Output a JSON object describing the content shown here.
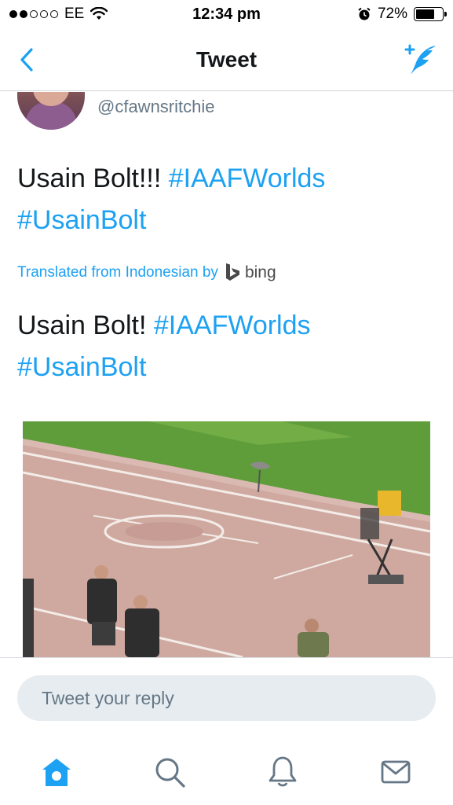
{
  "status_bar": {
    "carrier": "EE",
    "signal_filled": 2,
    "signal_total": 5,
    "time": "12:34 pm",
    "battery_text": "72%",
    "battery_level": 0.72,
    "icons": [
      "wifi-icon",
      "alarm-icon",
      "battery-icon"
    ]
  },
  "nav": {
    "title": "Tweet",
    "back_icon": "chevron-left-icon",
    "compose_icon": "compose-tweet-icon"
  },
  "tweet": {
    "handle": "@cfawnsritchie",
    "original_text": "Usain Bolt!!!",
    "original_hashtag_1": "#IAAFWorlds",
    "original_hashtag_2": "#UsainBolt",
    "translated_label": "Translated from Indonesian by",
    "translator": "bing",
    "translated_text": "Usain Bolt!",
    "translated_hashtag_1": "#IAAFWorlds",
    "translated_hashtag_2": "#UsainBolt"
  },
  "reply": {
    "placeholder": "Tweet your reply"
  },
  "tab_bar": {
    "tabs": [
      "home-icon",
      "search-icon",
      "notifications-icon",
      "messages-icon"
    ],
    "active": "home-icon"
  },
  "colors": {
    "accent": "#1da1f2",
    "text": "#14171a",
    "secondary": "#657786",
    "reply_bg": "#e6ecf0"
  }
}
